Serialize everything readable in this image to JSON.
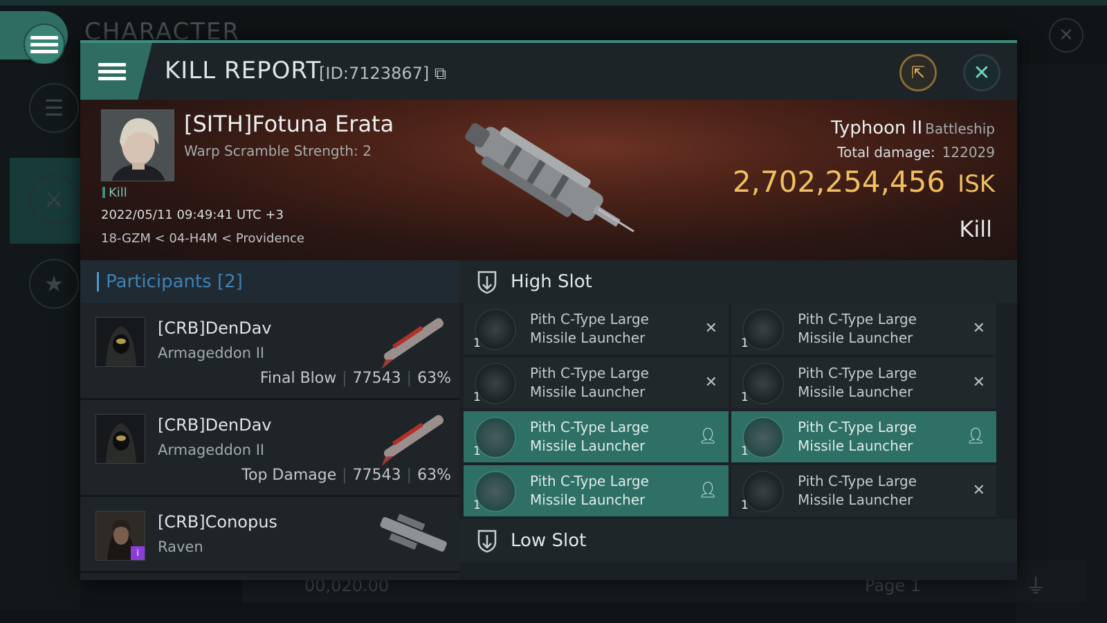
{
  "background": {
    "title": "CHARACTER",
    "bottom_text": "00,020.00",
    "page_label": "Page 1"
  },
  "header": {
    "title": "KILL REPORT",
    "id_label": "[ID:7123867]"
  },
  "victim": {
    "name": "[SITH]Fotuna Erata",
    "subtitle": "Warp Scramble Strength: 2",
    "tag": "Kill",
    "datetime": "2022/05/11 09:49:41 UTC +3",
    "location": "18-GZM < 04-H4M < Providence",
    "ship_name": "Typhoon II",
    "ship_class": "Battleship",
    "damage_label": "Total damage:",
    "damage_value": "122029",
    "isk_value": "2,702,254,456",
    "isk_unit": "ISK",
    "result": "Kill"
  },
  "participants": {
    "heading": "Participants [2]",
    "rows": [
      {
        "name": "[CRB]DenDav",
        "ship": "Armageddon II",
        "role": "Final Blow",
        "damage": "77543",
        "percent": "63%"
      },
      {
        "name": "[CRB]DenDav",
        "ship": "Armageddon II",
        "role": "Top Damage",
        "damage": "77543",
        "percent": "63%"
      },
      {
        "name": "[CRB]Conopus",
        "ship": "Raven"
      }
    ]
  },
  "high_slot": {
    "title": "High Slot",
    "items": [
      {
        "name": "Pith C-Type Large Missile Launcher",
        "qty": "1",
        "status": "destroyed"
      },
      {
        "name": "Pith C-Type Large Missile Launcher",
        "qty": "1",
        "status": "destroyed"
      },
      {
        "name": "Pith C-Type Large Missile Launcher",
        "qty": "1",
        "status": "destroyed"
      },
      {
        "name": "Pith C-Type Large Missile Launcher",
        "qty": "1",
        "status": "destroyed"
      },
      {
        "name": "Pith C-Type Large Missile Launcher",
        "qty": "1",
        "status": "dropped"
      },
      {
        "name": "Pith C-Type Large Missile Launcher",
        "qty": "1",
        "status": "dropped"
      },
      {
        "name": "Pith C-Type Large Missile Launcher",
        "qty": "1",
        "status": "dropped"
      },
      {
        "name": "Pith C-Type Large Missile Launcher",
        "qty": "1",
        "status": "destroyed"
      }
    ]
  },
  "low_slot": {
    "title": "Low Slot"
  },
  "colors": {
    "accent": "#3f8b7f",
    "isk": "#f0c060",
    "participants_heading": "#3e82b6",
    "dropped_row": "#2e6f66"
  }
}
